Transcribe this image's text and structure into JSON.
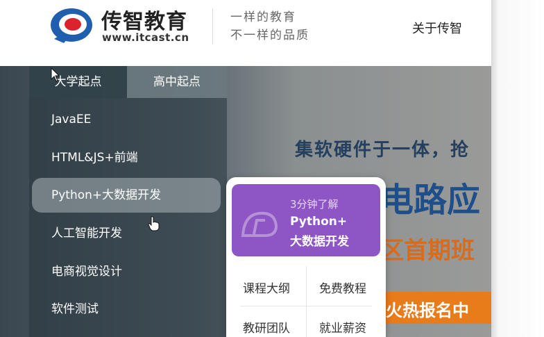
{
  "header": {
    "logo_title": "传智教育",
    "logo_url": "www.itcast.cn",
    "slogan_line1": "一样的教育",
    "slogan_line2": "不一样的品质",
    "about_label": "关于传智"
  },
  "menu": {
    "tabs": [
      {
        "label": "大学起点"
      },
      {
        "label": "高中起点"
      }
    ],
    "items": [
      {
        "label": "JavaEE"
      },
      {
        "label": "HTML&JS+前端"
      },
      {
        "label": "Python+大数据开发"
      },
      {
        "label": "人工智能开发"
      },
      {
        "label": "电商视觉设计"
      },
      {
        "label": "软件测试"
      }
    ],
    "active_index": 2
  },
  "popup": {
    "promo_sub": "3分钟了解",
    "promo_title_1": "Python+",
    "promo_title_2": "大数据开发",
    "links": [
      {
        "label": "课程大纲"
      },
      {
        "label": "免费教程"
      },
      {
        "label": "教研团队"
      },
      {
        "label": "就业薪资"
      }
    ]
  },
  "hero": {
    "line1": "集软硬件于一体，抢",
    "line2": "电路应",
    "line3": "区首期班",
    "cta": "火热报名中"
  },
  "colors": {
    "promo_purple": "#8e56c4",
    "hero_blue": "#1e4f8a",
    "hero_orange": "#e87b1a",
    "logo_red": "#d9232d",
    "logo_blue": "#1f5fae"
  }
}
